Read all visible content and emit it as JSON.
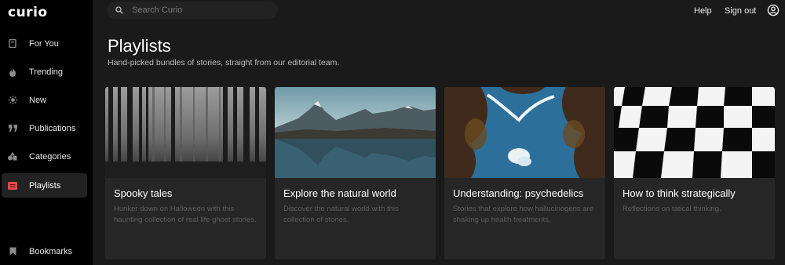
{
  "app": {
    "logo": "curio"
  },
  "sidebar": {
    "items": [
      {
        "label": "For You",
        "icon": "for-you-icon"
      },
      {
        "label": "Trending",
        "icon": "flame-icon"
      },
      {
        "label": "New",
        "icon": "sparkle-icon"
      },
      {
        "label": "Publications",
        "icon": "quote-icon"
      },
      {
        "label": "Categories",
        "icon": "shapes-icon"
      },
      {
        "label": "Playlists",
        "icon": "playlist-icon",
        "active": true
      }
    ],
    "bookmarks": {
      "label": "Bookmarks",
      "icon": "bookmark-icon"
    }
  },
  "topbar": {
    "search_placeholder": "Search Curio",
    "help": "Help",
    "sign_out": "Sign out",
    "account_icon": "account-icon"
  },
  "header": {
    "title": "Playlists",
    "subtitle": "Hand-picked bundles of stories, straight from our editorial team."
  },
  "playlists": [
    {
      "title": "Spooky tales",
      "description": "Hunker down on Halloween with this haunting collection of real life ghost stories.",
      "image": "foggy-forest"
    },
    {
      "title": "Explore the natural world",
      "description": "Discover the natural world with this collection of stories.",
      "image": "mountain-lake"
    },
    {
      "title": "Understanding: psychedelics",
      "description": "Stories that explore how hallucinogens are shaking up health treatments.",
      "image": "psychedelic-trees"
    },
    {
      "title": "How to think strategically",
      "description": "Reflections on tatical thinking.",
      "image": "checkerboard"
    }
  ],
  "colors": {
    "background": "#1a1a1a",
    "sidebar": "#000000",
    "card": "#262626",
    "muted_text": "#5e5e5e"
  }
}
